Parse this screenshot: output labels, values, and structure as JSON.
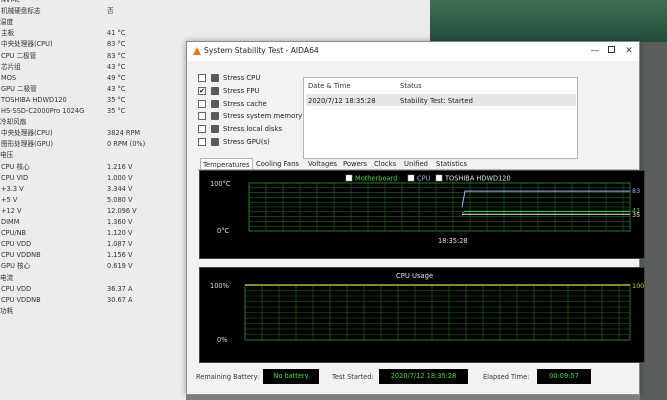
{
  "sensor_panel": {
    "top_rows": [
      {
        "label": "NVMe",
        "value": "",
        "cutoff": true
      },
      {
        "label": "机械硬盘标志",
        "value": "否"
      }
    ],
    "sections": [
      {
        "title": "温度",
        "rows": [
          {
            "label": "主板",
            "value": "41 °C"
          },
          {
            "label": "中央处理器(CPU)",
            "value": "83 °C"
          },
          {
            "label": "CPU 二极管",
            "value": "83 °C"
          },
          {
            "label": "芯片组",
            "value": "43 °C"
          },
          {
            "label": "MOS",
            "value": "49 °C"
          },
          {
            "label": "GPU 二极管",
            "value": "43 °C"
          },
          {
            "label": "TOSHIBA HDWD120",
            "value": "35 °C"
          },
          {
            "label": "HS-SSD-C2000Pro 1024G",
            "value": "35 °C"
          }
        ]
      },
      {
        "title": "冷却风扇",
        "rows": [
          {
            "label": "中央处理器(CPU)",
            "value": "3824 RPM"
          },
          {
            "label": "图形处理器(GPU)",
            "value": "0 RPM  (0%)"
          }
        ]
      },
      {
        "title": "电压",
        "rows": [
          {
            "label": "CPU 核心",
            "value": "1.216 V"
          },
          {
            "label": "CPU VID",
            "value": "1.000 V"
          },
          {
            "label": "+3.3 V",
            "value": "3.344 V"
          },
          {
            "label": "+5 V",
            "value": "5.080 V"
          },
          {
            "label": "+12 V",
            "value": "12.096 V"
          },
          {
            "label": "DIMM",
            "value": "1.360 V"
          },
          {
            "label": "CPU/NB",
            "value": "1.120 V"
          },
          {
            "label": "CPU VDD",
            "value": "1.087 V"
          },
          {
            "label": "CPU VDDNB",
            "value": "1.156 V"
          },
          {
            "label": "GPU 核心",
            "value": "0.619 V"
          }
        ]
      },
      {
        "title": "电流",
        "rows": [
          {
            "label": "CPU VDD",
            "value": "36.37 A"
          },
          {
            "label": "CPU VDDNB",
            "value": "30.67 A"
          }
        ]
      },
      {
        "title": "功耗",
        "rows": []
      }
    ]
  },
  "window": {
    "title": "System Stability Test - AIDA64",
    "controls": {
      "minimize": "—",
      "close": "✕"
    },
    "stress_options": [
      {
        "label": "Stress CPU",
        "checked": false
      },
      {
        "label": "Stress FPU",
        "checked": true
      },
      {
        "label": "Stress cache",
        "checked": false
      },
      {
        "label": "Stress system memory",
        "checked": false
      },
      {
        "label": "Stress local disks",
        "checked": false
      },
      {
        "label": "Stress GPU(s)",
        "checked": false
      }
    ],
    "status_table": {
      "headers": [
        "Date & Time",
        "Status"
      ],
      "rows": [
        {
          "datetime": "2020/7/12 18:35:28",
          "status": "Stability Test: Started"
        }
      ]
    },
    "tabs": [
      "Temperatures",
      "Cooling Fans",
      "Voltages",
      "Powers",
      "Clocks",
      "Unified",
      "Statistics"
    ],
    "active_tab": "Temperatures",
    "check_glyph": "✔",
    "bottom": {
      "battery_label": "Remaining Battery:",
      "battery_value": "No battery",
      "started_label": "Test Started:",
      "started_value": "2020/7/12 18:35:28",
      "elapsed_label": "Elapsed Time:",
      "elapsed_value": "00:09:57"
    }
  },
  "chart_data": [
    {
      "type": "line",
      "legend": [
        "Motherboard",
        "CPU",
        "TOSHIBA HDWD120"
      ],
      "ylim": [
        0,
        100
      ],
      "y_tick_labels": [
        "100°C",
        "0°C"
      ],
      "x_tick_label": "18:35:28",
      "series": [
        {
          "name": "Motherboard",
          "color": "#3fdc3f",
          "end_value": 41
        },
        {
          "name": "CPU",
          "color": "#9fb6ff",
          "end_value": 83
        },
        {
          "name": "TOSHIBA HDWD120",
          "color": "#e8e8e8",
          "end_value": 35
        }
      ],
      "value_labels": [
        "83",
        "41",
        "35"
      ]
    },
    {
      "type": "line",
      "title": "CPU Usage",
      "ylim": [
        0,
        100
      ],
      "y_tick_labels": [
        "100%",
        "0%"
      ],
      "series": [
        {
          "name": "CPU Usage",
          "color": "#d7dc3a",
          "end_value": 100
        }
      ],
      "value_labels": [
        "100%"
      ]
    }
  ]
}
